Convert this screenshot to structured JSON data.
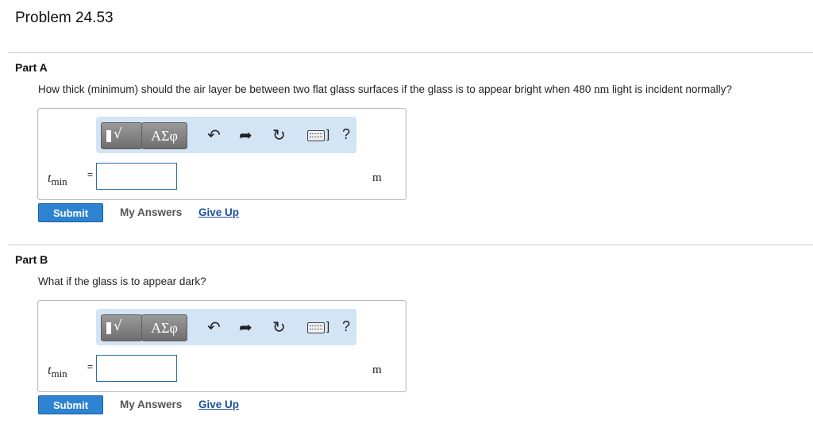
{
  "problem": {
    "title": "Problem 24.53"
  },
  "toolbar": {
    "template_icon_label": "√",
    "greek_label": "ΑΣφ",
    "undo_icon": "↶",
    "redo_icon": "➦",
    "reset_icon": "↻",
    "keyboard_bracket": "]",
    "help_label": "?"
  },
  "parts": [
    {
      "label": "Part A",
      "question_before": "How thick (minimum) should the air layer be between two flat glass surfaces if the glass is to appear bright when 480 ",
      "question_unit": "nm",
      "question_after": " light is incident normally?",
      "variable": "t",
      "variable_sub": "min",
      "equals": "=",
      "input_value": "",
      "unit": "m",
      "submit_label": "Submit",
      "my_answers_label": "My Answers",
      "give_up_label": "Give Up"
    },
    {
      "label": "Part B",
      "question": "What if the glass is to appear dark?",
      "variable": "t",
      "variable_sub": "min",
      "equals": "=",
      "input_value": "",
      "unit": "m",
      "submit_label": "Submit",
      "my_answers_label": "My Answers",
      "give_up_label": "Give Up"
    }
  ]
}
